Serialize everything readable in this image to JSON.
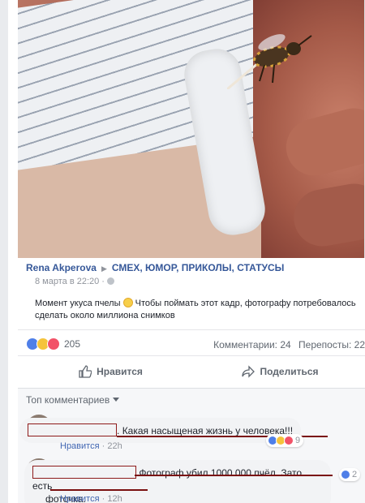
{
  "post": {
    "author": "Rena Akperova",
    "group": "СМЕХ, ЮМОР, ПРИКОЛЫ, СТАТУСЫ",
    "date": "8 марта в 22:20",
    "description_part1": "Момент укуса пчелы",
    "description_part2": "Чтобы поймать этот кадр, фотографу потребовалось сделать около миллиона снимков"
  },
  "reactions": {
    "count": "205",
    "comments": "Комментарии: 24",
    "shares": "Перепосты: 22",
    "types": [
      "like-icon",
      "wow-icon",
      "love-icon"
    ]
  },
  "actions": {
    "like_label": "Нравится",
    "share_label": "Поделиться"
  },
  "comments_section": {
    "sort_label": "Топ комментариев",
    "items": [
      {
        "prefix": ".",
        "text": "Какая насыщеная жизнь у человека!!!",
        "like_link": "Нравится",
        "time": "22h",
        "reactions_count": "9"
      },
      {
        "line1": "Фотограф убил 1000 000 пчёл. Зато есть",
        "line2": "фоточка.",
        "like_link": "Нравится",
        "time": "12h",
        "reactions_count": "2"
      }
    ]
  },
  "colors": {
    "link": "#365899",
    "muted": "#90949c",
    "like_blue": "#4f7fe8",
    "redaction": "#8e1a1a"
  }
}
